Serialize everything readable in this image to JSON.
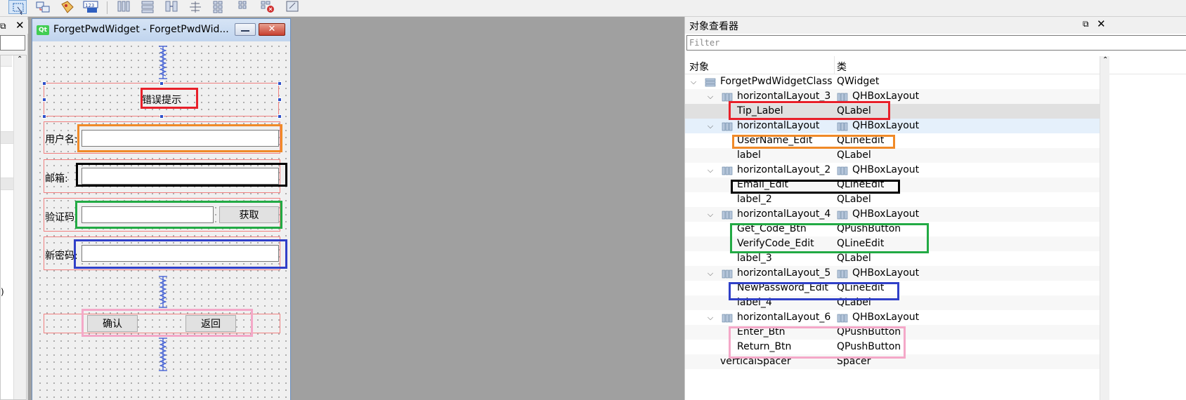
{
  "form_window": {
    "title": "ForgetPwdWidget - ForgetPwdWid...",
    "qt_badge": "Qt",
    "tip_label": "错误提示",
    "username_label": "用户名:",
    "email_label": "邮箱:",
    "code_label": "验证码:",
    "get_code_button": "获取",
    "new_password_label": "新密码:",
    "confirm_button": "确认",
    "return_button": "返回"
  },
  "left_dock": {
    "frag": ")"
  },
  "inspector": {
    "title": "对象查看器",
    "filter_placeholder": "Filter",
    "col_object": "对象",
    "col_class": "类",
    "rows": [
      {
        "name": "ForgetPwdWidgetClass",
        "cls": "QWidget"
      },
      {
        "name": "horizontalLayout_3",
        "cls": "QHBoxLayout"
      },
      {
        "name": "Tip_Label",
        "cls": "QLabel"
      },
      {
        "name": "horizontalLayout",
        "cls": "QHBoxLayout"
      },
      {
        "name": "UserName_Edit",
        "cls": "QLineEdit"
      },
      {
        "name": "label",
        "cls": "QLabel"
      },
      {
        "name": "horizontalLayout_2",
        "cls": "QHBoxLayout"
      },
      {
        "name": "Email_Edit",
        "cls": "QLineEdit"
      },
      {
        "name": "label_2",
        "cls": "QLabel"
      },
      {
        "name": "horizontalLayout_4",
        "cls": "QHBoxLayout"
      },
      {
        "name": "Get_Code_Btn",
        "cls": "QPushButton"
      },
      {
        "name": "VerifyCode_Edit",
        "cls": "QLineEdit"
      },
      {
        "name": "label_3",
        "cls": "QLabel"
      },
      {
        "name": "horizontalLayout_5",
        "cls": "QHBoxLayout"
      },
      {
        "name": "NewPassword_Edit",
        "cls": "QLineEdit"
      },
      {
        "name": "label_4",
        "cls": "QLabel"
      },
      {
        "name": "horizontalLayout_6",
        "cls": "QHBoxLayout"
      },
      {
        "name": "Enter_Btn",
        "cls": "QPushButton"
      },
      {
        "name": "Return_Btn",
        "cls": "QPushButton"
      },
      {
        "name": "verticalSpacer",
        "cls": "Spacer"
      }
    ]
  },
  "colors": {
    "annotation_red": "#e8202a",
    "annotation_orange": "#f08a28",
    "annotation_black": "#000000",
    "annotation_green": "#22aa44",
    "annotation_blue": "#3040c8",
    "annotation_pink": "#f4a8c8",
    "layout_border": "#f08080",
    "spacer_blue": "#3050d0"
  },
  "icons": [
    "select-widget-icon",
    "edit-signals-icon",
    "edit-buddies-icon",
    "edit-tab-order-icon",
    "lay-out-horizontally-icon",
    "lay-out-vertically-icon",
    "lay-out-splitter-icon",
    "lay-out-form-icon",
    "lay-out-grid-icon",
    "break-layout-icon",
    "adjust-size-icon",
    "qt-logo-icon",
    "minimize-icon",
    "close-icon",
    "float-icon",
    "layout-icon",
    "widget-icon"
  ]
}
